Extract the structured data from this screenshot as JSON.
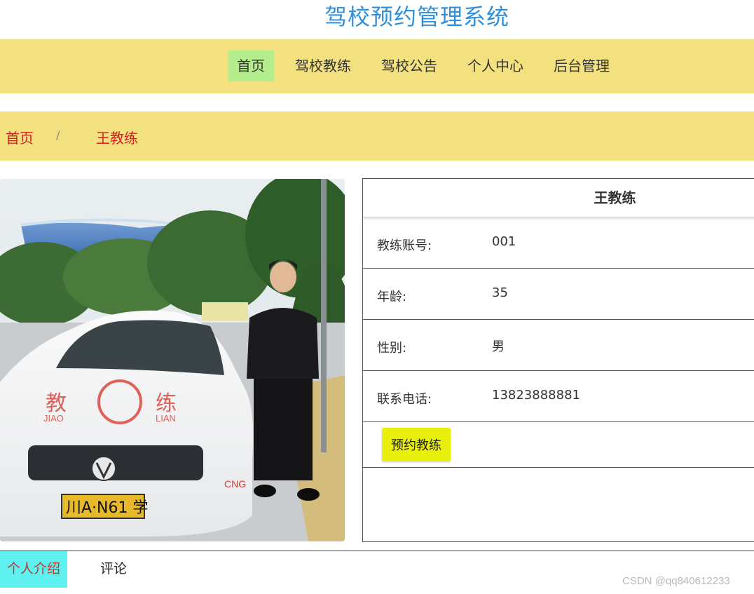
{
  "header": {
    "title": "驾校预约管理系统"
  },
  "nav": {
    "items": [
      {
        "label": "首页",
        "active": true
      },
      {
        "label": "驾校教练",
        "active": false
      },
      {
        "label": "驾校公告",
        "active": false
      },
      {
        "label": "个人中心",
        "active": false
      },
      {
        "label": "后台管理",
        "active": false
      }
    ]
  },
  "breadcrumb": {
    "home": "首页",
    "separator": "/",
    "current": "王教练"
  },
  "photo": {
    "car_text_left": "教",
    "car_text_right": "练",
    "car_pinyin_left": "JIAO",
    "car_pinyin_right": "LIAN",
    "plate": "川A·N61 学",
    "car_badge": "CNG"
  },
  "coach": {
    "name": "王教练",
    "fields": [
      {
        "label": "教练账号:",
        "value": "001"
      },
      {
        "label": "年龄:",
        "value": "35"
      },
      {
        "label": "性别:",
        "value": "男"
      },
      {
        "label": "联系电话:",
        "value": "13823888881"
      }
    ],
    "book_label": "预约教练"
  },
  "tabs": {
    "intro": "个人介绍",
    "comments": "评论"
  },
  "watermark": "CSDN @qq840612233",
  "colors": {
    "title_blue": "#2f8fd8",
    "nav_bg": "#f2e17e",
    "nav_active": "#b3ed8c",
    "crumb_red": "#d32121",
    "book_button": "#e8ef0b",
    "tab_active": "#5ff0f0"
  }
}
